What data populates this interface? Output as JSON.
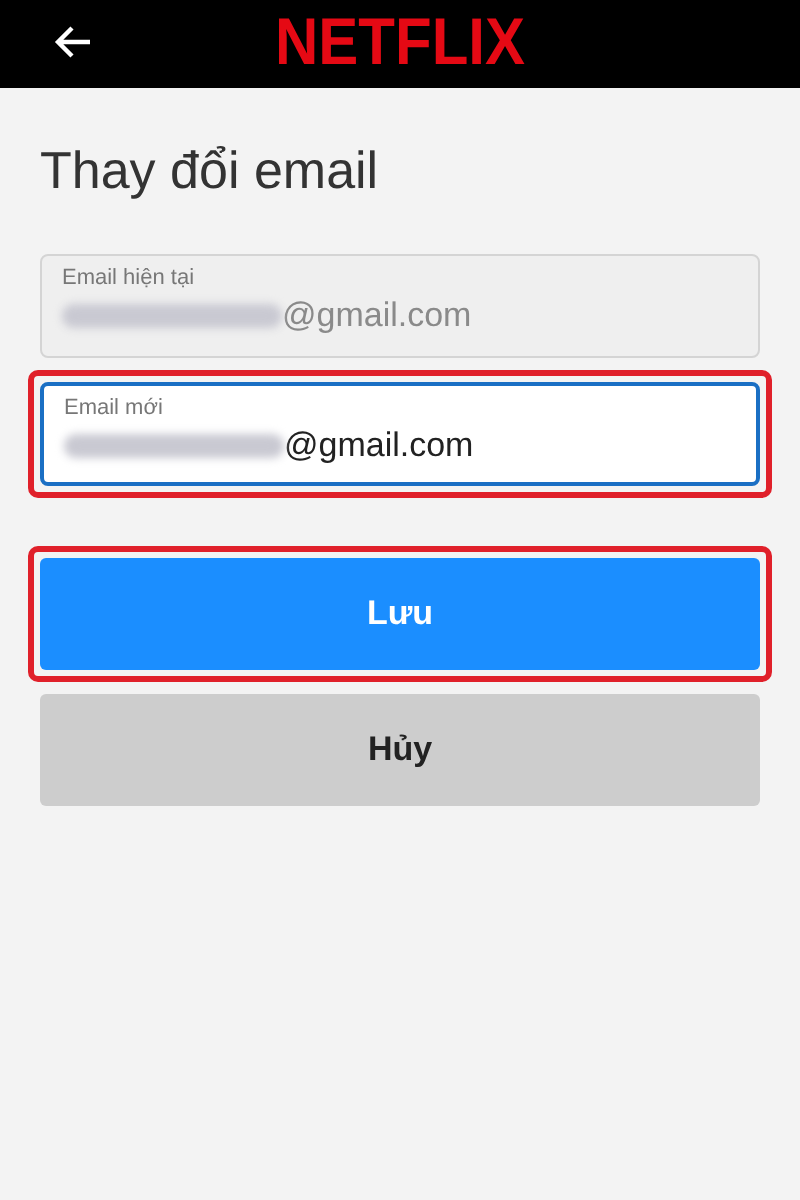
{
  "header": {
    "logo": "NETFLIX"
  },
  "title": "Thay đổi email",
  "fields": [
    {
      "label": "Email hiện tại",
      "value": "@gmail.com",
      "disabled": true,
      "focused": false,
      "highlighted": false
    },
    {
      "label": "Email mới",
      "value": "@gmail.com",
      "disabled": false,
      "focused": true,
      "highlighted": true
    }
  ],
  "buttons": [
    {
      "label": "Lưu",
      "kind": "primary",
      "highlighted": true
    },
    {
      "label": "Hủy",
      "kind": "secondary",
      "highlighted": false
    }
  ]
}
